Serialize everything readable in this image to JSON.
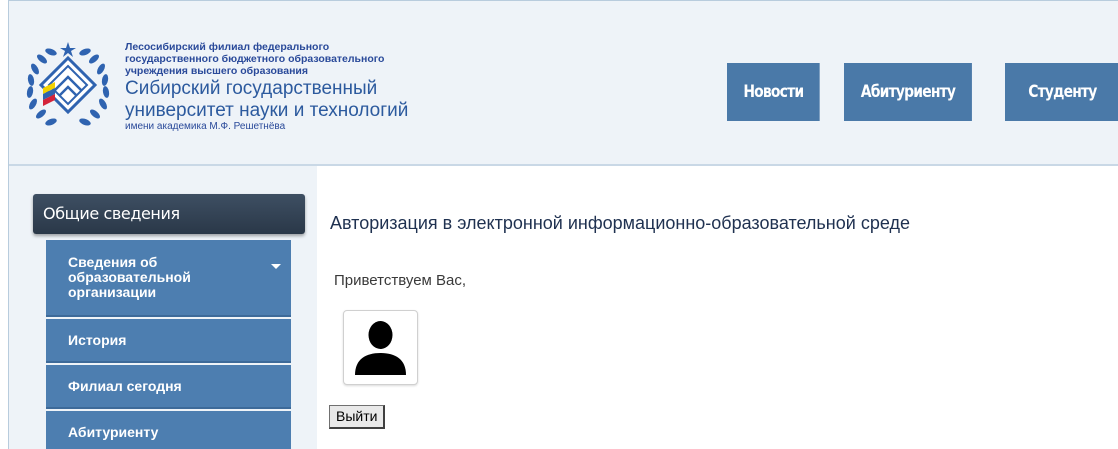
{
  "header": {
    "org_small_lines": [
      "Лесосибирский филиал федерального",
      "государственного бюджетного образовательного",
      "учреждения высшего образования"
    ],
    "org_big_lines": [
      "Сибирский государственный",
      "университет науки и технологий"
    ],
    "org_tiny": "имени академика М.Ф. Решетнёва"
  },
  "nav": {
    "items": [
      {
        "label": "Новости"
      },
      {
        "label": "Абитуриенту"
      },
      {
        "label": "Студенту"
      }
    ]
  },
  "sidebar": {
    "title": "Общие сведения",
    "items": [
      {
        "label_lines": [
          "Сведения об",
          "образовательной",
          "организации"
        ]
      },
      {
        "label": "История"
      },
      {
        "label": "Филиал сегодня"
      },
      {
        "label": "Абитуриенту"
      }
    ]
  },
  "main": {
    "title": "Авторизация в электронной информационно-образовательной среде",
    "greeting": "Приветствуем Вас,",
    "logout_label": "Выйти"
  },
  "colors": {
    "nav_bg": "#4a79a8",
    "sidebar_item_bg": "#4d7eb0",
    "sidebar_title_bg": "#2a3848",
    "header_bg": "#eef3f8"
  }
}
